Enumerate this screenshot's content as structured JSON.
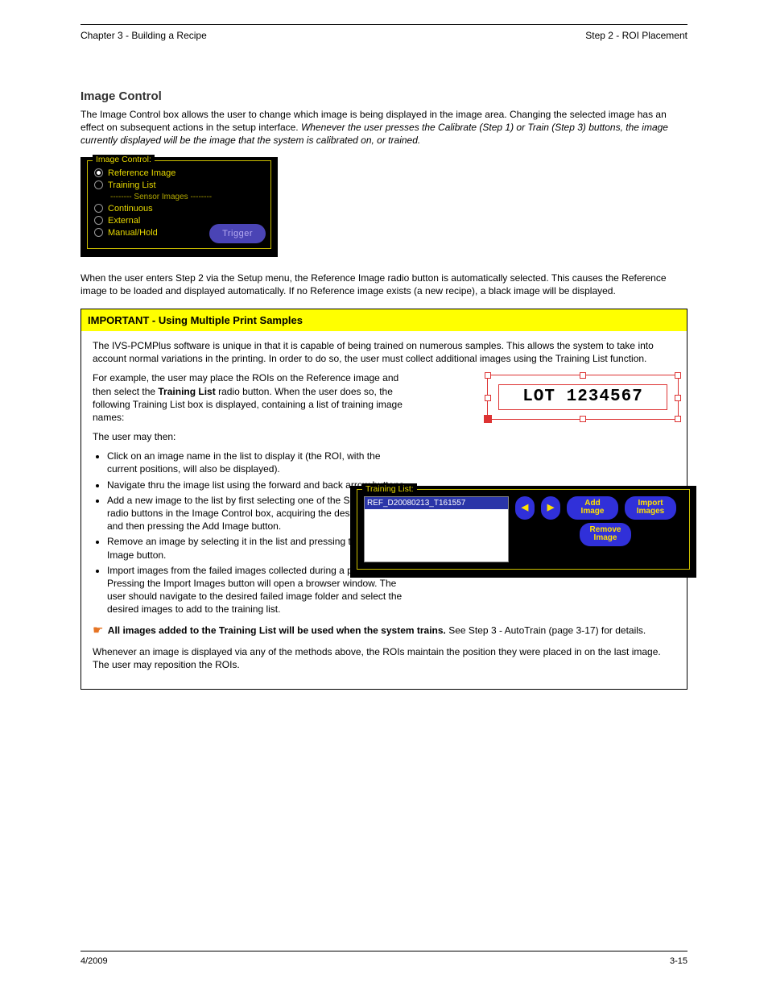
{
  "header": {
    "left": "Chapter 3 - Building a Recipe",
    "right": "Step 2 - ROI Placement"
  },
  "section": {
    "heading": "Image Control",
    "para1_before": "The Image Control box allows the user to change which image is being displayed in the image area. Changing the selected image has an effect on subsequent actions in the setup interface. ",
    "para1_note": "Whenever the user presses the Calibrate (Step 1) or Train (Step 3) buttons, the image currently displayed will be the image that the system is calibrated on, or trained.",
    "para_below_panel": "When the user enters Step 2 via the Setup menu, the Reference Image radio button is automatically selected. This causes the Reference image to be loaded and displayed automatically. If no Reference image exists (a new recipe), a black image will be displayed."
  },
  "image_control_panel": {
    "legend": "Image Control:",
    "radios": [
      {
        "label": "Reference Image",
        "selected": true
      },
      {
        "label": "Training List",
        "selected": false
      }
    ],
    "divider": "-------- Sensor Images --------",
    "radios2": [
      {
        "label": "Continuous",
        "selected": false
      },
      {
        "label": "External",
        "selected": false
      },
      {
        "label": "Manual/Hold",
        "selected": false
      }
    ],
    "trigger": "Trigger"
  },
  "important": {
    "title": "IMPORTANT - Using Multiple Print Samples",
    "p1": "The IVS-PCMPlus software is unique in that it is capable of being trained on numerous samples. This allows the system to take into account normal variations in the printing. In order to do so, the user must collect additional images using the Training List function.",
    "p2_a": "For example, the user may place the ROIs on the Reference image and then select the ",
    "p2_b": "Training List",
    "p2_c": " radio button. When the user does so, the following Training List box is displayed, containing a list of training image names:",
    "lot_text": "LOT 1234567",
    "training_panel": {
      "legend": "Training List:",
      "item": "REF_D20080213_T161557",
      "prev": "◀",
      "next": "▶",
      "add": "Add\nImage",
      "import": "Import\nImages",
      "remove": "Remove\nImage"
    },
    "bullets_intro": "The user may then:",
    "bullets": [
      "Click on an image name in the list to display it (the ROI, with the current positions, will also be displayed).",
      "Navigate thru the image list using the forward and back arrow buttons.",
      "Add a new image to the list by first selecting one of the Sensor Image radio buttons in the Image Control box, acquiring the desired image, and then pressing the Add Image button.",
      "Remove an image by selecting it in the list and pressing the Remove Image button.",
      "Import images from the failed images collected during a previous run. Pressing the Import Images button will open a browser window. The user should navigate to the desired failed image folder and select the desired images to add to the training list."
    ],
    "note_a": "All images added to the Training List will be used when the system trains.",
    "note_b": "See Step 3 - AutoTrain (page 3-17) for details.",
    "trailing": "Whenever an image is displayed via any of the methods above, the ROIs maintain the position they were placed in on the last image. The user may reposition the ROIs."
  },
  "footer": {
    "left": "4/2009",
    "right": "3-15"
  }
}
